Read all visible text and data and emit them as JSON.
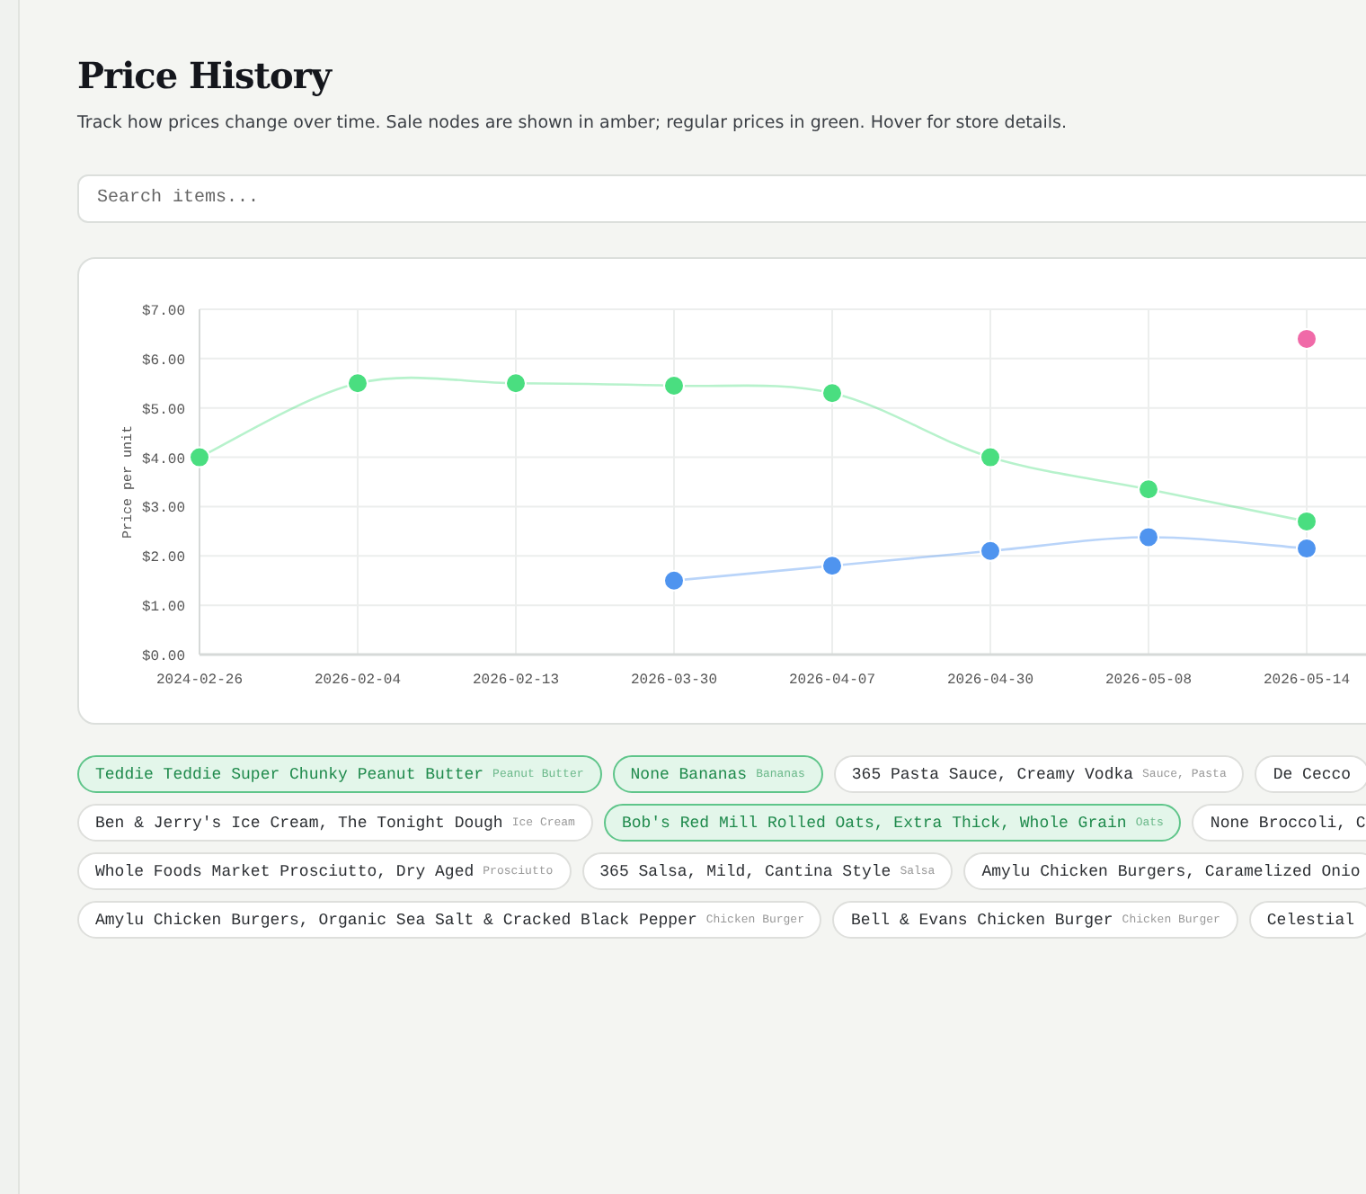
{
  "header": {
    "title": "Price History",
    "subtitle": "Track how prices change over time. Sale nodes are shown in amber; regular prices in green. Hover for store details."
  },
  "search": {
    "placeholder": "Search items..."
  },
  "chart": {
    "chart_data": {
      "type": "line",
      "ylabel": "Price per unit",
      "categories": [
        "2024-02-26",
        "2026-02-04",
        "2026-02-13",
        "2026-03-30",
        "2026-04-07",
        "2026-04-30",
        "2026-05-08",
        "2026-05-14"
      ],
      "series": [
        {
          "color": "#4ade80",
          "marker": "circle",
          "values": [
            4.0,
            5.5,
            5.5,
            5.45,
            5.3,
            4.0,
            3.35,
            2.7
          ]
        },
        {
          "color": "#4f94ef",
          "marker": "circle",
          "values": [
            null,
            null,
            null,
            1.5,
            1.8,
            2.1,
            2.38,
            2.15
          ]
        },
        {
          "color": "#f06aa8",
          "marker": "circle",
          "values": [
            null,
            null,
            null,
            null,
            null,
            null,
            null,
            6.4
          ]
        }
      ],
      "ylim": [
        0,
        7
      ],
      "grid": true,
      "yticks": [
        {
          "value": 0,
          "label": "$0.00"
        },
        {
          "value": 1,
          "label": "$1.00"
        },
        {
          "value": 2,
          "label": "$2.00"
        },
        {
          "value": 3,
          "label": "$3.00"
        },
        {
          "value": 4,
          "label": "$4.00"
        },
        {
          "value": 5,
          "label": "$5.00"
        },
        {
          "value": 6,
          "label": "$6.00"
        },
        {
          "value": 7,
          "label": "$7.00"
        }
      ]
    }
  },
  "item_rows": [
    [
      {
        "name": "Teddie Teddie Super Chunky Peanut Butter",
        "category": "Peanut Butter",
        "selected": true
      },
      {
        "name": "None Bananas",
        "category": "Bananas",
        "selected": true
      },
      {
        "name": "365 Pasta Sauce, Creamy Vodka",
        "category": "Sauce, Pasta",
        "selected": false
      },
      {
        "name": "De Cecco",
        "selected": false
      }
    ],
    [
      {
        "name": "Ben & Jerry's Ice Cream, The Tonight Dough",
        "category": "Ice Cream",
        "selected": false
      },
      {
        "name": "Bob's Red Mill Rolled Oats, Extra Thick, Whole Grain",
        "category": "Oats",
        "selected": true
      },
      {
        "name": "None Broccoli, C",
        "selected": false
      }
    ],
    [
      {
        "name": "Whole Foods Market Prosciutto, Dry Aged",
        "category": "Prosciutto",
        "selected": false
      },
      {
        "name": "365 Salsa, Mild, Cantina Style",
        "category": "Salsa",
        "selected": false
      },
      {
        "name": "Amylu Chicken Burgers, Caramelized Onio",
        "selected": false
      }
    ],
    [
      {
        "name": "Amylu Chicken Burgers, Organic Sea Salt & Cracked Black Pepper",
        "category": "Chicken Burger",
        "selected": false
      },
      {
        "name": "Bell & Evans Chicken Burger",
        "category": "Chicken Burger",
        "selected": false
      },
      {
        "name": "Celestial",
        "selected": false
      }
    ]
  ]
}
